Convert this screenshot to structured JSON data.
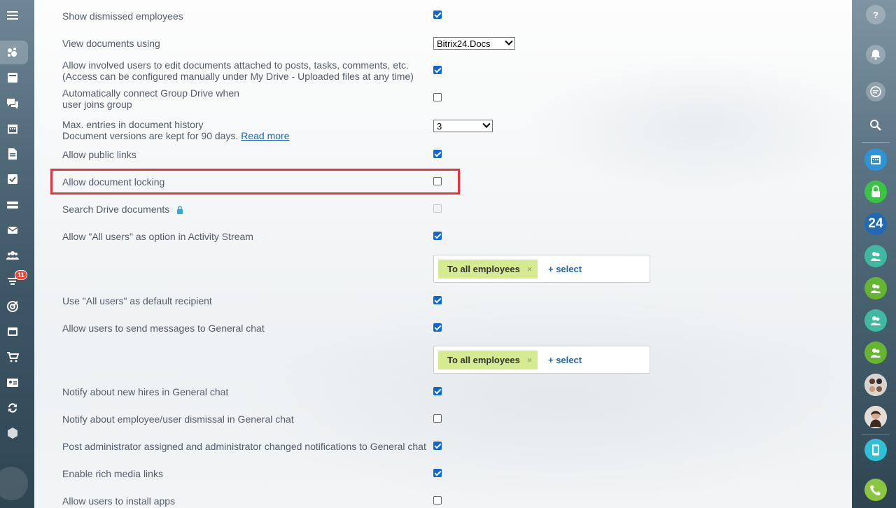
{
  "left_sidebar": {
    "icons": [
      "menu-icon",
      "stream-icon",
      "feed-icon",
      "chat-icon",
      "calendar-icon",
      "document-icon",
      "tasks-icon",
      "drive-icon",
      "mail-icon",
      "groups-icon",
      "crm-icon",
      "target-icon",
      "sites-icon",
      "shop-icon",
      "contact-card-icon",
      "sync-icon",
      "box-icon"
    ],
    "badge": "11"
  },
  "settings": {
    "show_dismissed": {
      "label": "Show dismissed employees",
      "checked": true
    },
    "view_documents": {
      "label": "View documents using",
      "value": "Bitrix24.Docs"
    },
    "allow_involved_edit": {
      "label_line1": "Allow involved users to edit documents attached to posts, tasks, comments, etc.",
      "label_line2": "(Access can be configured manually under My Drive - Uploaded files at any time)",
      "checked": true
    },
    "auto_connect_group": {
      "label_line1": "Automatically connect Group Drive when",
      "label_line2": "user joins group",
      "checked": false
    },
    "max_history": {
      "label_line1": "Max. entries in document history",
      "label_line2": "Document versions are kept for 90 days.",
      "read_more": "Read more",
      "value": "3"
    },
    "allow_public_links": {
      "label": "Allow public links",
      "checked": true
    },
    "allow_locking": {
      "label": "Allow document locking",
      "checked": false
    },
    "search_drive": {
      "label": "Search Drive documents",
      "checked": false,
      "disabled": true
    },
    "all_users_option": {
      "label": "Allow \"All users\" as option in Activity Stream",
      "checked": true
    },
    "tag_box_1": {
      "tag": "To all employees",
      "remove": "×",
      "select": "+ select"
    },
    "all_users_default": {
      "label": "Use \"All users\" as default recipient",
      "checked": true
    },
    "send_general_chat": {
      "label": "Allow users to send messages to General chat",
      "checked": true
    },
    "tag_box_2": {
      "tag": "To all employees",
      "remove": "×",
      "select": "+ select"
    },
    "notify_new_hires": {
      "label": "Notify about new hires in General chat",
      "checked": true
    },
    "notify_dismissal": {
      "label": "Notify about employee/user dismissal in General chat",
      "checked": false
    },
    "post_admin_notifications": {
      "label": "Post administrator assigned and administrator changed notifications to General chat",
      "checked": true
    },
    "rich_media": {
      "label": "Enable rich media links",
      "checked": true
    },
    "install_apps": {
      "label": "Allow users to install apps",
      "checked": false
    }
  },
  "right_sidebar": {
    "items": [
      "help-icon",
      "notifications-icon",
      "messages-icon",
      "search-icon",
      "calendar-icon",
      "lock-icon",
      "bitrix24-logo",
      "group-chat-icon",
      "group-chat-icon",
      "group-chat-icon",
      "group-chat-icon",
      "avatar",
      "avatar",
      "device-icon",
      "phone-icon"
    ],
    "logo_text": "24"
  },
  "colors": {
    "checkbox_on": "#0c66d6",
    "highlight": "#e8323c",
    "tag_bg": "#d4ec8f",
    "link": "#2067b0"
  }
}
